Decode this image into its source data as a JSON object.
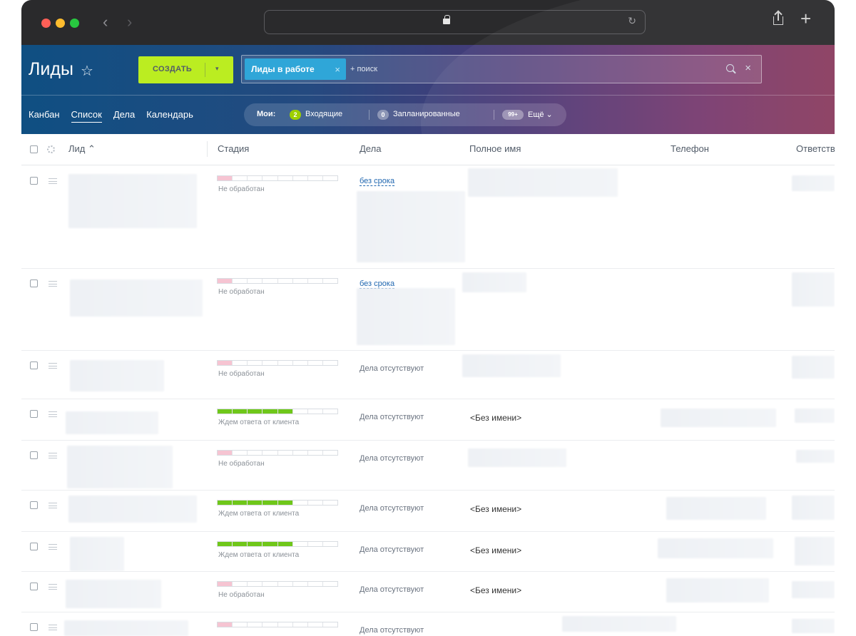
{
  "header": {
    "title": "Лиды",
    "create_label": "СОЗДАТЬ",
    "filter_chip": "Лиды в работе",
    "search_placeholder": "+ поиск",
    "views": [
      "Канбан",
      "Список",
      "Дела",
      "Календарь"
    ],
    "active_view": "Список",
    "counters": {
      "mine": "Мои:",
      "incoming_count": "2",
      "incoming": "Входящие",
      "planned_count": "0",
      "planned": "Запланированные",
      "more_count": "99+",
      "more": "Ещё ⌄"
    }
  },
  "colors": {
    "create": "#bbed21",
    "chip": "#2fa6d8",
    "stage_new": "#f6c4d2",
    "stage_wait": "#6fc71a",
    "link": "#2067b0"
  },
  "table": {
    "columns": [
      "Лид ⌃",
      "Стадия",
      "Дела",
      "Полное имя",
      "Телефон",
      "Ответстве"
    ],
    "rows": [
      {
        "stage": "Не обработан",
        "stage_level": 1,
        "deal": "без срока",
        "deal_link": true,
        "fullname": ""
      },
      {
        "stage": "Не обработан",
        "stage_level": 1,
        "deal": "без срока",
        "deal_link": true,
        "fullname": ""
      },
      {
        "stage": "Не обработан",
        "stage_level": 1,
        "deal": "Дела отсутствуют",
        "deal_link": false,
        "fullname": ""
      },
      {
        "stage": "Ждем ответа от клиента",
        "stage_level": 5,
        "deal": "Дела отсутствуют",
        "deal_link": false,
        "fullname": "<Без имени>"
      },
      {
        "stage": "Не обработан",
        "stage_level": 1,
        "deal": "Дела отсутствуют",
        "deal_link": false,
        "fullname": ""
      },
      {
        "stage": "Ждем ответа от клиента",
        "stage_level": 5,
        "deal": "Дела отсутствуют",
        "deal_link": false,
        "fullname": "<Без имени>"
      },
      {
        "stage": "Ждем ответа от клиента",
        "stage_level": 5,
        "deal": "Дела отсутствуют",
        "deal_link": false,
        "fullname": "<Без имени>"
      },
      {
        "stage": "Не обработан",
        "stage_level": 1,
        "deal": "Дела отсутствуют",
        "deal_link": false,
        "fullname": "<Без имени>"
      },
      {
        "stage": "",
        "stage_level": 1,
        "deal": "Дела отсутствуют",
        "deal_link": false,
        "fullname": ""
      }
    ]
  }
}
